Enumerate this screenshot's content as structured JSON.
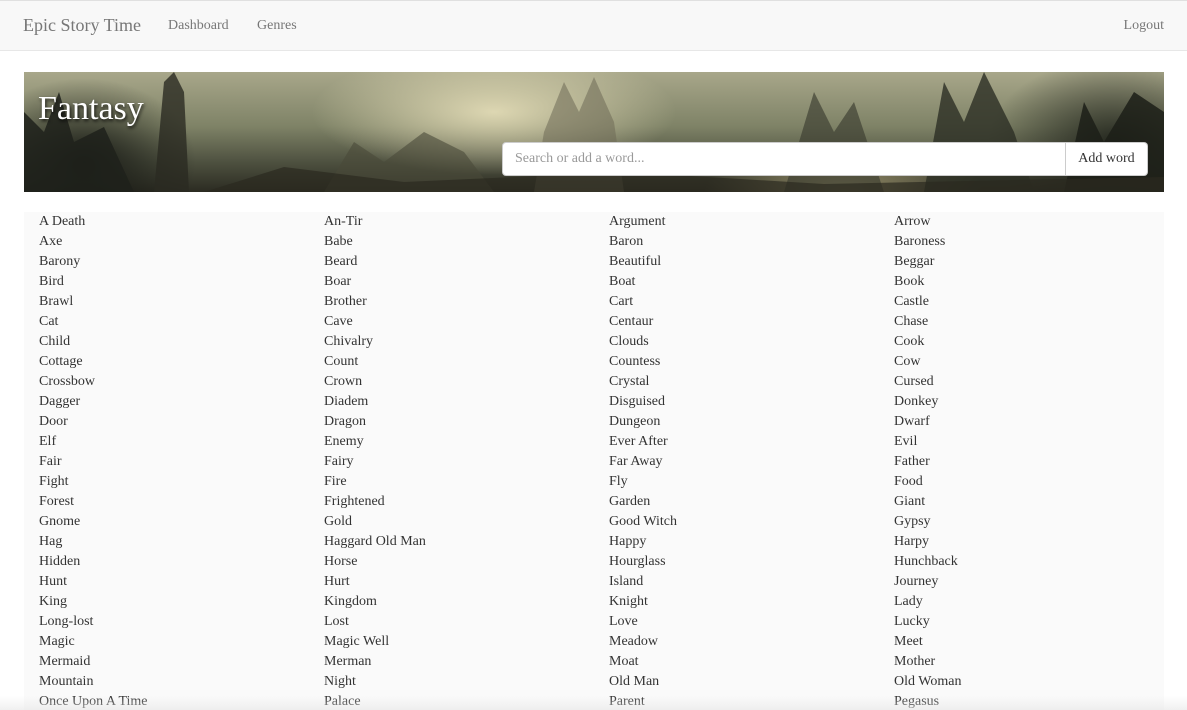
{
  "nav": {
    "brand": "Epic Story Time",
    "links": [
      "Dashboard",
      "Genres"
    ],
    "logout": "Logout"
  },
  "hero": {
    "title": "Fantasy",
    "search_placeholder": "Search or add a word...",
    "add_label": "Add word"
  },
  "words": [
    "A Death",
    "An-Tir",
    "Argument",
    "Arrow",
    "Axe",
    "Babe",
    "Baron",
    "Baroness",
    "Barony",
    "Beard",
    "Beautiful",
    "Beggar",
    "Bird",
    "Boar",
    "Boat",
    "Book",
    "Brawl",
    "Brother",
    "Cart",
    "Castle",
    "Cat",
    "Cave",
    "Centaur",
    "Chase",
    "Child",
    "Chivalry",
    "Clouds",
    "Cook",
    "Cottage",
    "Count",
    "Countess",
    "Cow",
    "Crossbow",
    "Crown",
    "Crystal",
    "Cursed",
    "Dagger",
    "Diadem",
    "Disguised",
    "Donkey",
    "Door",
    "Dragon",
    "Dungeon",
    "Dwarf",
    "Elf",
    "Enemy",
    "Ever After",
    "Evil",
    "Fair",
    "Fairy",
    "Far Away",
    "Father",
    "Fight",
    "Fire",
    "Fly",
    "Food",
    "Forest",
    "Frightened",
    "Garden",
    "Giant",
    "Gnome",
    "Gold",
    "Good Witch",
    "Gypsy",
    "Hag",
    "Haggard Old Man",
    "Happy",
    "Harpy",
    "Hidden",
    "Horse",
    "Hourglass",
    "Hunchback",
    "Hunt",
    "Hurt",
    "Island",
    "Journey",
    "King",
    "Kingdom",
    "Knight",
    "Lady",
    "Long-lost",
    "Lost",
    "Love",
    "Lucky",
    "Magic",
    "Magic Well",
    "Meadow",
    "Meet",
    "Mermaid",
    "Merman",
    "Moat",
    "Mother",
    "Mountain",
    "Night",
    "Old Man",
    "Old Woman",
    "Once Upon A Time",
    "Palace",
    "Parent",
    "Pegasus"
  ]
}
